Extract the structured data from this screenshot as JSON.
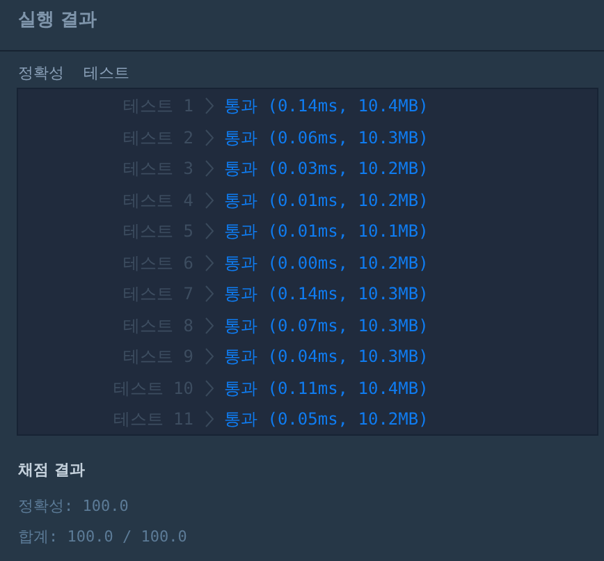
{
  "header": {
    "title": "실행 결과"
  },
  "tabs": [
    {
      "label": "정확성"
    },
    {
      "label": "테스트"
    }
  ],
  "tests": [
    {
      "label": "테스트 1",
      "result": "통과 (0.14ms, 10.4MB)",
      "kind": "pass"
    },
    {
      "label": "테스트 2",
      "result": "통과 (0.06ms, 10.3MB)",
      "kind": "pass"
    },
    {
      "label": "테스트 3",
      "result": "통과 (0.03ms, 10.2MB)",
      "kind": "pass"
    },
    {
      "label": "테스트 4",
      "result": "통과 (0.01ms, 10.2MB)",
      "kind": "pass"
    },
    {
      "label": "테스트 5",
      "result": "통과 (0.01ms, 10.1MB)",
      "kind": "pass"
    },
    {
      "label": "테스트 6",
      "result": "통과 (0.00ms, 10.2MB)",
      "kind": "pass"
    },
    {
      "label": "테스트 7",
      "result": "통과 (0.14ms, 10.3MB)",
      "kind": "pass"
    },
    {
      "label": "테스트 8",
      "result": "통과 (0.07ms, 10.3MB)",
      "kind": "pass"
    },
    {
      "label": "테스트 9",
      "result": "통과 (0.04ms, 10.3MB)",
      "kind": "pass"
    },
    {
      "label": "테스트 10",
      "result": "통과 (0.11ms, 10.4MB)",
      "kind": "pass"
    },
    {
      "label": "테스트 11",
      "result": "통과 (0.05ms, 10.2MB)",
      "kind": "pass"
    }
  ],
  "summary": {
    "title": "채점 결과",
    "lines": [
      "정확성: 100.0",
      "합계: 100.0 / 100.0"
    ]
  }
}
